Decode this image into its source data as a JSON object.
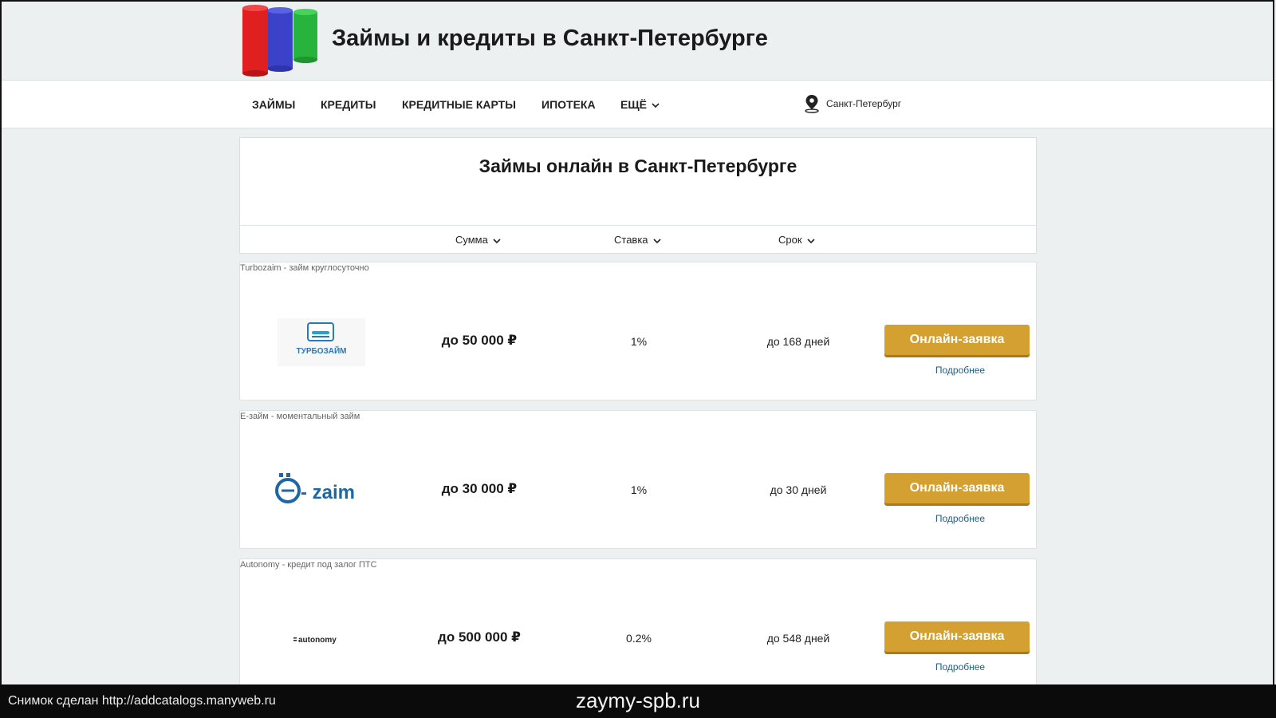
{
  "site": {
    "title": "Займы и кредиты в Санкт-Петербурге"
  },
  "nav": {
    "items": [
      {
        "label": "ЗАЙМЫ"
      },
      {
        "label": "КРЕДИТЫ"
      },
      {
        "label": "КРЕДИТНЫЕ КАРТЫ"
      },
      {
        "label": "ИПОТЕКА"
      },
      {
        "label": "ЕЩЁ"
      }
    ],
    "location": "Санкт-Петербург"
  },
  "main": {
    "title": "Займы онлайн в Санкт-Петербурге",
    "sort": {
      "amount": "Сумма",
      "rate": "Ставка",
      "term": "Срок"
    }
  },
  "offers": [
    {
      "caption": "Turbozaim - займ круглосуточно",
      "logo_text": "ТУРБОЗАЙМ",
      "amount": "до 50 000 ₽",
      "rate": "1%",
      "term": "до 168 дней",
      "apply_label": "Онлайн-заявка",
      "more_label": "Подробнее"
    },
    {
      "caption": "Е-займ - моментальный займ",
      "logo_text": "- zaim",
      "amount": "до 30 000 ₽",
      "rate": "1%",
      "term": "до 30 дней",
      "apply_label": "Онлайн-заявка",
      "more_label": "Подробнее"
    },
    {
      "caption": "Autonomy - кредит под залог ПТС",
      "logo_text": "autonomy",
      "amount": "до 500 000 ₽",
      "rate": "0.2%",
      "term": "до 548 дней",
      "apply_label": "Онлайн-заявка",
      "more_label": "Подробнее"
    }
  ],
  "footer": {
    "left": "Снимок сделан http://addcatalogs.manyweb.ru",
    "center": "zaymy-spb.ru"
  },
  "colors": {
    "accent": "#d4a031",
    "link": "#1f5f8b",
    "background": "#ecf0f1"
  }
}
